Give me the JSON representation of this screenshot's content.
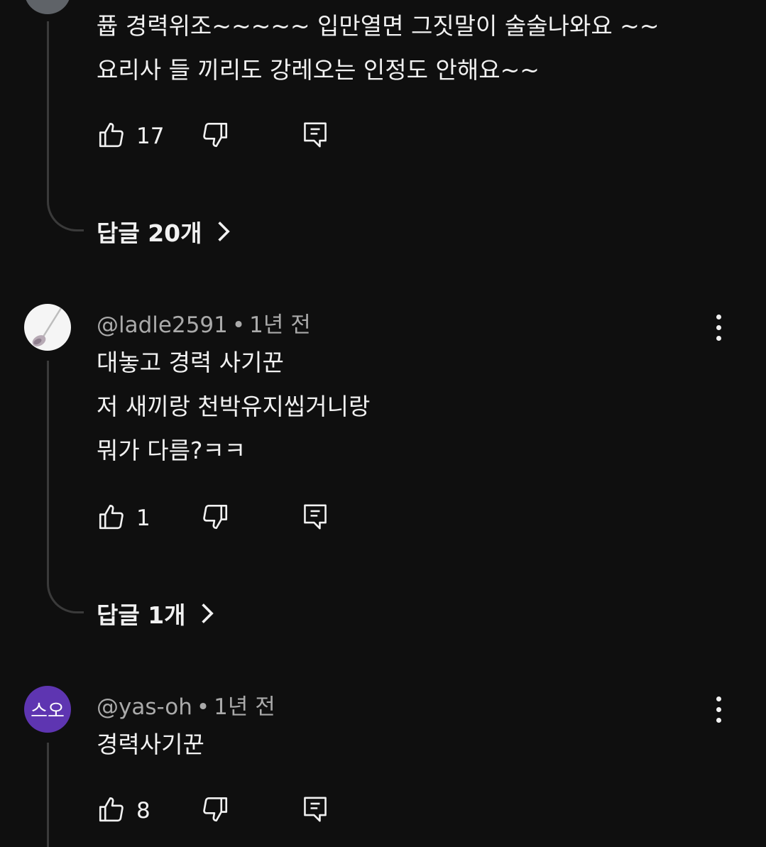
{
  "comments": [
    {
      "lines": [
        "퓹  경력위조~~~~~ 입만열면 그짓말이 술술나와요 ~~",
        "요리사 들 끼리도 강레오는 인정도 안해요~~"
      ],
      "likes": "17",
      "replies": "답글 20개"
    },
    {
      "username": "@ladle2591",
      "time": "1년 전",
      "lines": [
        "대놓고 경력 사기꾼",
        "저 새끼랑 천박유지씹거니랑",
        "뭐가 다름?ㅋㅋ"
      ],
      "likes": "1",
      "replies": "답글 1개"
    },
    {
      "username": "@yas-oh",
      "avatar_text": "스오",
      "avatar_color": "#5e35b1",
      "time": "1년 전",
      "lines": [
        "경력사기꾼"
      ],
      "likes": "8"
    }
  ],
  "separator": "•"
}
